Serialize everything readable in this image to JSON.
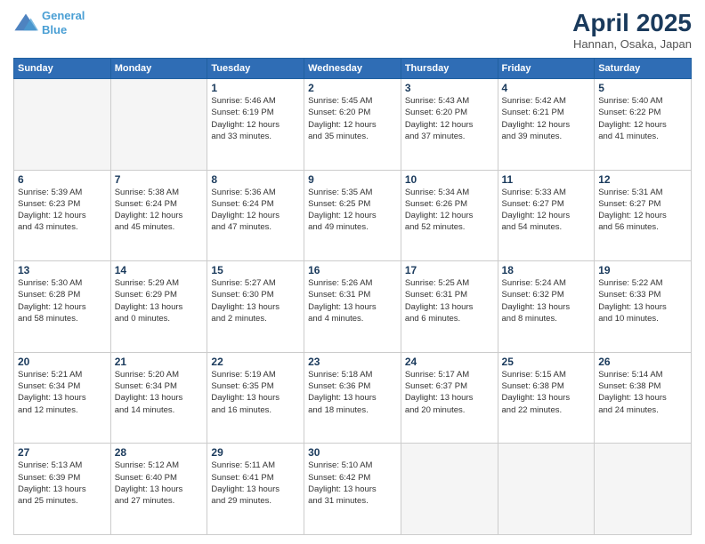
{
  "header": {
    "logo_line1": "General",
    "logo_line2": "Blue",
    "month": "April 2025",
    "location": "Hannan, Osaka, Japan"
  },
  "days_of_week": [
    "Sunday",
    "Monday",
    "Tuesday",
    "Wednesday",
    "Thursday",
    "Friday",
    "Saturday"
  ],
  "weeks": [
    [
      {
        "day": "",
        "info": ""
      },
      {
        "day": "",
        "info": ""
      },
      {
        "day": "1",
        "info": "Sunrise: 5:46 AM\nSunset: 6:19 PM\nDaylight: 12 hours\nand 33 minutes."
      },
      {
        "day": "2",
        "info": "Sunrise: 5:45 AM\nSunset: 6:20 PM\nDaylight: 12 hours\nand 35 minutes."
      },
      {
        "day": "3",
        "info": "Sunrise: 5:43 AM\nSunset: 6:20 PM\nDaylight: 12 hours\nand 37 minutes."
      },
      {
        "day": "4",
        "info": "Sunrise: 5:42 AM\nSunset: 6:21 PM\nDaylight: 12 hours\nand 39 minutes."
      },
      {
        "day": "5",
        "info": "Sunrise: 5:40 AM\nSunset: 6:22 PM\nDaylight: 12 hours\nand 41 minutes."
      }
    ],
    [
      {
        "day": "6",
        "info": "Sunrise: 5:39 AM\nSunset: 6:23 PM\nDaylight: 12 hours\nand 43 minutes."
      },
      {
        "day": "7",
        "info": "Sunrise: 5:38 AM\nSunset: 6:24 PM\nDaylight: 12 hours\nand 45 minutes."
      },
      {
        "day": "8",
        "info": "Sunrise: 5:36 AM\nSunset: 6:24 PM\nDaylight: 12 hours\nand 47 minutes."
      },
      {
        "day": "9",
        "info": "Sunrise: 5:35 AM\nSunset: 6:25 PM\nDaylight: 12 hours\nand 49 minutes."
      },
      {
        "day": "10",
        "info": "Sunrise: 5:34 AM\nSunset: 6:26 PM\nDaylight: 12 hours\nand 52 minutes."
      },
      {
        "day": "11",
        "info": "Sunrise: 5:33 AM\nSunset: 6:27 PM\nDaylight: 12 hours\nand 54 minutes."
      },
      {
        "day": "12",
        "info": "Sunrise: 5:31 AM\nSunset: 6:27 PM\nDaylight: 12 hours\nand 56 minutes."
      }
    ],
    [
      {
        "day": "13",
        "info": "Sunrise: 5:30 AM\nSunset: 6:28 PM\nDaylight: 12 hours\nand 58 minutes."
      },
      {
        "day": "14",
        "info": "Sunrise: 5:29 AM\nSunset: 6:29 PM\nDaylight: 13 hours\nand 0 minutes."
      },
      {
        "day": "15",
        "info": "Sunrise: 5:27 AM\nSunset: 6:30 PM\nDaylight: 13 hours\nand 2 minutes."
      },
      {
        "day": "16",
        "info": "Sunrise: 5:26 AM\nSunset: 6:31 PM\nDaylight: 13 hours\nand 4 minutes."
      },
      {
        "day": "17",
        "info": "Sunrise: 5:25 AM\nSunset: 6:31 PM\nDaylight: 13 hours\nand 6 minutes."
      },
      {
        "day": "18",
        "info": "Sunrise: 5:24 AM\nSunset: 6:32 PM\nDaylight: 13 hours\nand 8 minutes."
      },
      {
        "day": "19",
        "info": "Sunrise: 5:22 AM\nSunset: 6:33 PM\nDaylight: 13 hours\nand 10 minutes."
      }
    ],
    [
      {
        "day": "20",
        "info": "Sunrise: 5:21 AM\nSunset: 6:34 PM\nDaylight: 13 hours\nand 12 minutes."
      },
      {
        "day": "21",
        "info": "Sunrise: 5:20 AM\nSunset: 6:34 PM\nDaylight: 13 hours\nand 14 minutes."
      },
      {
        "day": "22",
        "info": "Sunrise: 5:19 AM\nSunset: 6:35 PM\nDaylight: 13 hours\nand 16 minutes."
      },
      {
        "day": "23",
        "info": "Sunrise: 5:18 AM\nSunset: 6:36 PM\nDaylight: 13 hours\nand 18 minutes."
      },
      {
        "day": "24",
        "info": "Sunrise: 5:17 AM\nSunset: 6:37 PM\nDaylight: 13 hours\nand 20 minutes."
      },
      {
        "day": "25",
        "info": "Sunrise: 5:15 AM\nSunset: 6:38 PM\nDaylight: 13 hours\nand 22 minutes."
      },
      {
        "day": "26",
        "info": "Sunrise: 5:14 AM\nSunset: 6:38 PM\nDaylight: 13 hours\nand 24 minutes."
      }
    ],
    [
      {
        "day": "27",
        "info": "Sunrise: 5:13 AM\nSunset: 6:39 PM\nDaylight: 13 hours\nand 25 minutes."
      },
      {
        "day": "28",
        "info": "Sunrise: 5:12 AM\nSunset: 6:40 PM\nDaylight: 13 hours\nand 27 minutes."
      },
      {
        "day": "29",
        "info": "Sunrise: 5:11 AM\nSunset: 6:41 PM\nDaylight: 13 hours\nand 29 minutes."
      },
      {
        "day": "30",
        "info": "Sunrise: 5:10 AM\nSunset: 6:42 PM\nDaylight: 13 hours\nand 31 minutes."
      },
      {
        "day": "",
        "info": ""
      },
      {
        "day": "",
        "info": ""
      },
      {
        "day": "",
        "info": ""
      }
    ]
  ]
}
